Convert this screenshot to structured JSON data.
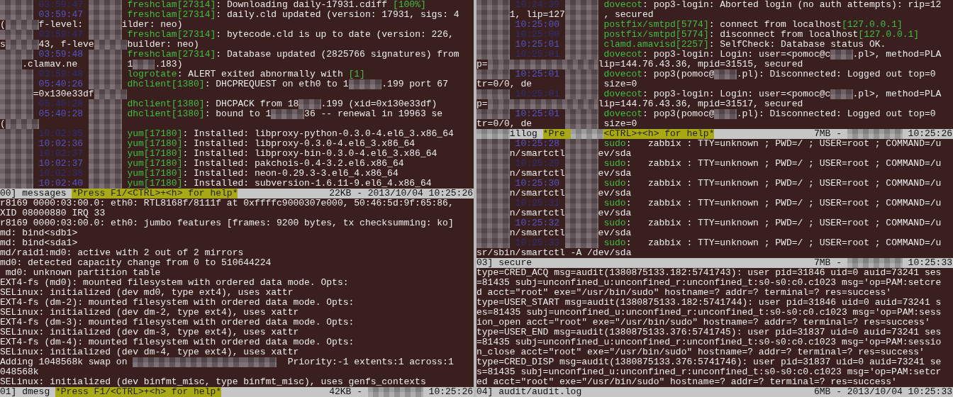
{
  "left_column": [
    {
      "lines": [
        {
          "kind": "entry",
          "time": "03:59:47",
          "dim": true,
          "prog": "freshclam[27314]",
          "msg": [
            ": Downloading daily-17931.cdiff ",
            {
              "kind": "num",
              "text": "[100%]"
            }
          ]
        },
        {
          "kind": "entry",
          "time": "03:59:47",
          "dim": false,
          "prog": "freshclam[27314]",
          "msg": [
            ": daily.cld updated (version: 17931, sigs: 4"
          ]
        },
        {
          "kind": "wrap",
          "parts": [
            "(",
            {
              "kind": "redact-m"
            },
            "f-level: ",
            {
              "kind": "redact-m"
            },
            "ilder: neo)"
          ]
        },
        {
          "kind": "entry",
          "time": "03:59:47",
          "dim": true,
          "prog": "freshclam[27314]",
          "msg": [
            ": bytecode.cld is up to date (version: 226,"
          ]
        },
        {
          "kind": "wrap",
          "parts": [
            "s",
            {
              "kind": "redact-m"
            },
            "43, f-leve",
            {
              "kind": "redact-m"
            },
            "builder: neo)"
          ]
        },
        {
          "kind": "entry",
          "time": "03:59:48",
          "dim": false,
          "prog": "freshclam[27314]",
          "msg": [
            ": Database updated (2825766 signatures) from"
          ]
        },
        {
          "kind": "wrap",
          "parts": [
            {
              "kind": "redact-s"
            },
            ".clamav.ne  ",
            {
              "kind": "redact-m"
            },
            " 1",
            {
              "kind": "redact-s"
            },
            ".183)"
          ]
        },
        {
          "kind": "entry",
          "time": "03:59:48",
          "dim": true,
          "prog": "logrotate",
          "msg": [
            ": ALERT exited abnormally with ",
            {
              "kind": "num",
              "text": "[1]"
            }
          ]
        },
        {
          "kind": "entry",
          "time": "05:40:26",
          "dim": false,
          "prog": "dhclient[1380]",
          "msg": [
            ": DHCPREQUEST on eth0 to 1",
            {
              "kind": "redact-m"
            },
            ".199 port 67"
          ]
        },
        {
          "kind": "wrap",
          "parts": [
            {
              "kind": "redact-m"
            },
            "=0x130e33df",
            {
              "kind": "redact-m"
            }
          ]
        },
        {
          "kind": "entry",
          "time": "05:40:28",
          "dim": true,
          "prog": "dhclient[1380]",
          "msg": [
            ": DHCPACK from 18",
            {
              "kind": "redact-s"
            },
            ".199 (xid=0x130e33df)"
          ]
        },
        {
          "kind": "entry",
          "time": "05:40:28",
          "dim": false,
          "prog": "dhclient[1380]",
          "msg": [
            ": bound to 1",
            {
              "kind": "redact-m"
            },
            "36 -- renewal in 19963 se"
          ]
        },
        {
          "kind": "wrap",
          "parts": [
            "(",
            {
              "kind": "redact-m"
            },
            {
              "kind": "gap"
            },
            {
              "kind": "redact-m"
            }
          ]
        },
        {
          "kind": "entry",
          "time": "10:02:35",
          "dim": true,
          "prog": "yum[17180]",
          "msg": [
            ": Installed: libproxy-python-0.3.0-4.el6_3.x86_64"
          ]
        },
        {
          "kind": "entry",
          "time": "10:02:36",
          "dim": false,
          "prog": "yum[17180]",
          "msg": [
            ": Installed: libproxy-0.3.0-4.el6_3.x86_64"
          ]
        },
        {
          "kind": "entry",
          "time": "10:02:37",
          "dim": true,
          "prog": "yum[17180]",
          "msg": [
            ": Installed: libproxy-bin-0.3.0-4.el6_3.x86_64"
          ]
        },
        {
          "kind": "entry",
          "time": "10:02:37",
          "dim": false,
          "prog": "yum[17180]",
          "msg": [
            ": Installed: pakchois-0.4-3.2.el6.x86_64"
          ]
        },
        {
          "kind": "entry",
          "time": "10:02:38",
          "dim": true,
          "prog": "yum[17180]",
          "msg": [
            ": Installed: neon-0.29.3-3.el6_4.x86_64"
          ]
        },
        {
          "kind": "entry",
          "time": "10:02:40",
          "dim": false,
          "prog": "yum[17180]",
          "msg": [
            ": Installed: subversion-1.6.11-9.el6_4.x86_64"
          ]
        }
      ],
      "status": {
        "label": [
          "00] messages"
        ],
        "help": [
          "*Press F1/<CTRL>+<h> for help*"
        ],
        "info": [
          "22KB - 2013/10/04 10:25:26"
        ]
      }
    },
    {
      "lines": [
        "r8169 0000:03:00.0: eth0: RTL8168f/8111f at 0xffffc9000307e000, 50:46:5d:9f:65:86,",
        "XID 08000880 IRQ 33",
        "r8169 0000:03:00.0: eth0: jumbo features [frames: 9200 bytes, tx checksumming: ko]",
        "md: bind<sdb1>",
        "md: bind<sda1>",
        "md/raid1:md0: active with 2 out of 2 mirrors",
        "md0: detected capacity change from 0 to 510644224",
        " md0: unknown partition table",
        "EXT4-fs (md0): mounted filesystem with ordered data mode. Opts:",
        "SELinux: initialized (dev md0, type ext4), uses xattr",
        "EXT4-fs (dm-2): mounted filesystem with ordered data mode. Opts:",
        "SELinux: initialized (dev dm-2, type ext4), uses xattr",
        "EXT4-fs (dm-3): mounted filesystem with ordered data mode. Opts:",
        "SELinux: initialized (dev dm-3, type ext4), uses xattr",
        "EXT4-fs (dm-4): mounted filesystem with ordered data mode. Opts:",
        "SELinux: initialized (dev dm-4, type ext4), uses xattr",
        {
          "kind": "wrap",
          "parts": [
            "Adding 1048568k swap on ",
            {
              "kind": "redact-xl"
            },
            {
              "kind": "redact-m"
            },
            "  Priority:-1 extents:1 across:1"
          ]
        },
        "048568k",
        "SELinux: initialized (dev binfmt_misc, type binfmt_misc), uses genfs_contexts"
      ],
      "status": {
        "label": [
          "01] dmesg"
        ],
        "help": [
          "*Press F1/<CTRL>+<h> for help*"
        ],
        "info": [
          "42KB - ",
          {
            "kind": "redact-l"
          },
          " 10:25:26"
        ]
      }
    }
  ],
  "right_column": [
    {
      "lines": [
        {
          "kind": "entry",
          "time": "10:24:39",
          "dim": true,
          "prog": "dovecot",
          "msg": [
            ": pop3-login: Aborted login (no auth attempts): rip=12"
          ]
        },
        {
          "kind": "wrap",
          "parts": [
            {
              "kind": "redact-m"
            },
            "1, lip=127",
            {
              "kind": "redact-m"
            },
            " , secured"
          ]
        },
        {
          "kind": "entry",
          "time": "10:25:00",
          "dim": false,
          "prog": "postfix/smtpd[5774]",
          "msg": [
            ": connect from localhost",
            {
              "kind": "num",
              "text": "[127.0.0.1]"
            }
          ]
        },
        {
          "kind": "entry",
          "time": "10:25:00",
          "dim": true,
          "prog": "postfix/smtpd[5774]",
          "msg": [
            ": disconnect from localhost",
            {
              "kind": "num",
              "text": "[127.0.0.1]"
            }
          ]
        },
        {
          "kind": "entry",
          "time": "10:25:01",
          "dim": false,
          "prog": "clamd.amavisd[2257]",
          "msg": [
            ": SelfCheck: Database status OK."
          ]
        },
        {
          "kind": "entry",
          "time": "10:25:01",
          "dim": true,
          "prog": "dovecot",
          "msg": [
            ": pop3-login: Login: user=<pomoc@c",
            {
              "kind": "redact-s"
            },
            ".pl>, method=PLA"
          ]
        },
        {
          "kind": "wrap",
          "parts": [
            "p=",
            {
              "kind": "redact-xl"
            },
            "lip=144.76.43.36, mpid=31515, secured"
          ]
        },
        {
          "kind": "entry",
          "time": "10:25:01",
          "dim": false,
          "prog": "dovecot",
          "msg": [
            ": pop3(pomoc@",
            {
              "kind": "redact-s"
            },
            ".pl): Disconnected: Logged out top=0"
          ]
        },
        {
          "kind": "wrap",
          "parts": [
            "tr=0/0, de      ",
            {
              "kind": "redact-m"
            },
            " size=0"
          ]
        },
        {
          "kind": "entry",
          "time": "10:25:01",
          "dim": true,
          "prog": "dovecot",
          "msg": [
            ": pop3-login: Login: user=<pomoc@c",
            {
              "kind": "redact-s"
            },
            ".pl>, method=PLA"
          ]
        },
        {
          "kind": "wrap",
          "parts": [
            "p=",
            {
              "kind": "redact-xl"
            },
            "lip=144.76.43.36, mpid=31517, secured"
          ]
        },
        {
          "kind": "entry",
          "time": "10:25:01",
          "dim": false,
          "prog": "dovecot",
          "msg": [
            ": pop3(pomoc@",
            {
              "kind": "redact-s"
            },
            ".pl): Disconnected: Logged out top=0"
          ]
        },
        {
          "kind": "wrap",
          "parts": [
            "tr=0/0, de      ",
            {
              "kind": "redact-m"
            },
            " size=0"
          ]
        }
      ],
      "status": {
        "label": [
          {
            "kind": "redact-m"
          },
          "illog"
        ],
        "help": [
          "*Pre ",
          {
            "kind": "redact-m"
          },
          "<CTRL>+<h> for help*"
        ],
        "info": [
          "7MB - ",
          {
            "kind": "redact-l"
          },
          " 10:25:26"
        ]
      }
    },
    {
      "lines": [
        {
          "kind": "entry",
          "time": "10:25:28",
          "dim": false,
          "prog": "sudo",
          "msg": [
            ":   zabbix : TTY=unknown ; PWD=/ ; USER=root ; COMMAND=/u"
          ]
        },
        {
          "kind": "wrap",
          "parts": [
            {
              "kind": "redact-m"
            },
            "n/smartctl",
            {
              "kind": "redact-m"
            },
            "ev/sda"
          ]
        },
        {
          "kind": "entry",
          "time": "10:25:29",
          "dim": true,
          "prog": "sudo",
          "msg": [
            ":   zabbix : TTY=unknown ; PWD=/ ; USER=root ; COMMAND=/u"
          ]
        },
        {
          "kind": "wrap",
          "parts": [
            {
              "kind": "redact-m"
            },
            "n/smartctl",
            {
              "kind": "redact-m"
            },
            "ev/sda"
          ]
        },
        {
          "kind": "entry",
          "time": "10:25:30",
          "dim": false,
          "prog": "sudo",
          "msg": [
            ":   zabbix : TTY=unknown ; PWD=/ ; USER=root ; COMMAND=/u"
          ]
        },
        {
          "kind": "wrap",
          "parts": [
            {
              "kind": "redact-m"
            },
            "n/smartctl",
            {
              "kind": "redact-m"
            },
            "ev/sda"
          ]
        },
        {
          "kind": "entry",
          "time": "10:25:31",
          "dim": true,
          "prog": "sudo",
          "msg": [
            ":   zabbix : TTY=unknown ; PWD=/ ; USER=root ; COMMAND=/u"
          ]
        },
        {
          "kind": "wrap",
          "parts": [
            {
              "kind": "redact-m"
            },
            "n/smartctl",
            {
              "kind": "redact-m"
            },
            "ev/sda"
          ]
        },
        {
          "kind": "entry",
          "time": "10:25:32",
          "dim": false,
          "prog": "sudo",
          "msg": [
            ":   zabbix : TTY=unknown ; PWD=/ ; USER=root ; COMMAND=/u"
          ]
        },
        {
          "kind": "wrap",
          "parts": [
            {
              "kind": "redact-m"
            },
            "n/smartctl",
            {
              "kind": "redact-m"
            },
            "ev/sda"
          ]
        },
        {
          "kind": "entry",
          "time": "10:25:33",
          "dim": true,
          "prog": "sudo",
          "msg": [
            ":   zabbix : TTY=unknown ; PWD=/ ; USER=root ; COMMAND=/u"
          ]
        },
        "sr/sbin/smartctl -A /dev/sda"
      ],
      "status": {
        "label": [
          "03] secure"
        ],
        "info": [
          "7MB - ",
          {
            "kind": "redact-l"
          },
          " 10:25:33"
        ]
      }
    },
    {
      "lines": [
        "type=CRED_ACQ msg=audit(1380875133.182:5741743): user pid=31846 uid=0 auid=73241 ses",
        "=81435 subj=unconfined_u:unconfined_r:unconfined_t:s0-s0:c0.c1023 msg='op=PAM:setcre",
        "d acct=\"root\" exe=\"/usr/bin/sudo\" hostname=? addr=? terminal=? res=success'",
        "type=USER_START msg=audit(1380875133.182:5741744): user pid=31846 uid=0 auid=73241 s",
        "es=81435 subj=unconfined_u:unconfined_r:unconfined_t:s0-s0:c0.c1023 msg='op=PAM:sess",
        "ion_open acct=\"root\" exe=\"/usr/bin/sudo\" hostname=? addr=? terminal=? res=success'",
        "type=USER_END msg=audit(1380875133.376:5741745): user pid=31837 uid=0 auid=73241 ses",
        "=81435 subj=unconfined_u:unconfined_r:unconfined_t:s0-s0:c0.c1023 msg='op=PAM:sessio",
        "n_close acct=\"root\" exe=\"/usr/bin/sudo\" hostname=? addr=? terminal=? res=success'",
        "type=CRED_DISP msg=audit(1380875133.376:5741746): user pid=31837 uid=0 auid=73241 se",
        "s=81435 subj=unconfined_u:unconfined_r:unconfined_t:s0-s0:c0.c1023 msg='op=PAM:setcr",
        "ed acct=\"root\" exe=\"/usr/bin/sudo\" hostname=? addr=? terminal=? res=success'"
      ],
      "status": {
        "label": [
          "04] audit/audit.log"
        ],
        "info": [
          "6MB - 2013/10/04 10:25:33"
        ]
      }
    }
  ]
}
